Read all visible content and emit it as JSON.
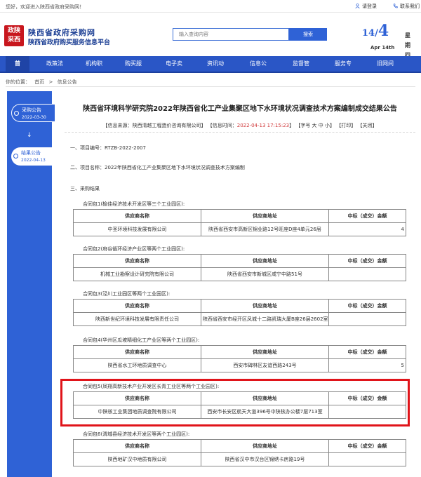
{
  "topbar": {
    "welcome": "您好，欢迎进入陕西省政府采购网！",
    "login": "请登录",
    "contact": "联系我们"
  },
  "header": {
    "logo_mark_top": "政陕",
    "logo_mark_bottom": "采西",
    "title": "陕西省政府采购网",
    "subtitle": "陕西省政府购买服务信息平台",
    "search_placeholder": "输入查询内容",
    "search_button": "搜索",
    "date_day": "14",
    "date_month": "4",
    "date_english": "Apr 14th",
    "weekday": "星期四"
  },
  "nav": [
    "首",
    "政策法",
    "机构职",
    "购买服",
    "电子卖",
    "资讯动",
    "信息公",
    "监督管",
    "服务专",
    "旧网间"
  ],
  "breadcrumb": [
    "你的位置：",
    "首页",
    ">",
    "信息公告"
  ],
  "sidebar": {
    "items": [
      {
        "label": "采购公告",
        "date": "2022-03-30"
      },
      {
        "label": "结果公告",
        "date": "2022-04-13"
      }
    ]
  },
  "article": {
    "title": "陕西省环境科学研究院2022年陕西省化工产业集聚区地下水环境状况调查技术方案编制成交结果公告",
    "source": "【信息来源：陕西清越工程造价咨询有限公司】",
    "time_label": "【信息时间：",
    "time_value": "2022-04-13 17:15:23",
    "time_end": "】",
    "font": "【字号 大 中 小】",
    "print": "【打印】",
    "close": "【关闭】",
    "section1": "一、项目编号：RTZB-2022-2007",
    "section2": "二、项目名称：2022年陕西省化工产业集聚区地下水环境状况调查技术方案编制",
    "section3": "三、采购结果",
    "headers": [
      "供应商名称",
      "供应商地址",
      "中标（成交）金额"
    ],
    "packages": [
      {
        "title": "合同包1(榆佳经济技术开发区等三个工业园区):",
        "supplier": "中圣环境科技发展有限公司",
        "address": "陕西省西安市高新区锦业路12号旺座D座4单元26层",
        "amount": "4"
      },
      {
        "title": "合同包2(府谷循环经济产业区等两个工业园区):",
        "supplier": "机械工业勘察设计研究院有限公司",
        "address": "陕西省西安市新城区咸宁中路51号",
        "amount": ""
      },
      {
        "title": "合同包3(泾川工业园区等两个工业园区):",
        "supplier": "陕西新世纪环境科技发展有限责任公司",
        "address": "陕西省西安市经开区凤城十二路凯瑞大厦B座26层2602室",
        "amount": ""
      },
      {
        "title": "合同包4(华州区瓜坡精细化工产业区等两个工业园区):",
        "supplier": "陕西省水工环地质调查中心",
        "address": "西安市碑林区友谊西路243号",
        "amount": "5"
      },
      {
        "title": "合同包5(凤翔高新技术产业开发区长青工业区等两个工业园区):",
        "supplier": "中陕核工业集团地质调查院有限公司",
        "address": "西安市长安区航天大道396号中陕核办公楼7层713室",
        "amount": ""
      },
      {
        "title": "合同包6(渭城县经济技术开发区等两个工业园区):",
        "supplier": "陕西地矿汉中地质有限公司",
        "address": "陕西省汉中市汉台区锦绣卡房路19号",
        "amount": ""
      }
    ]
  }
}
